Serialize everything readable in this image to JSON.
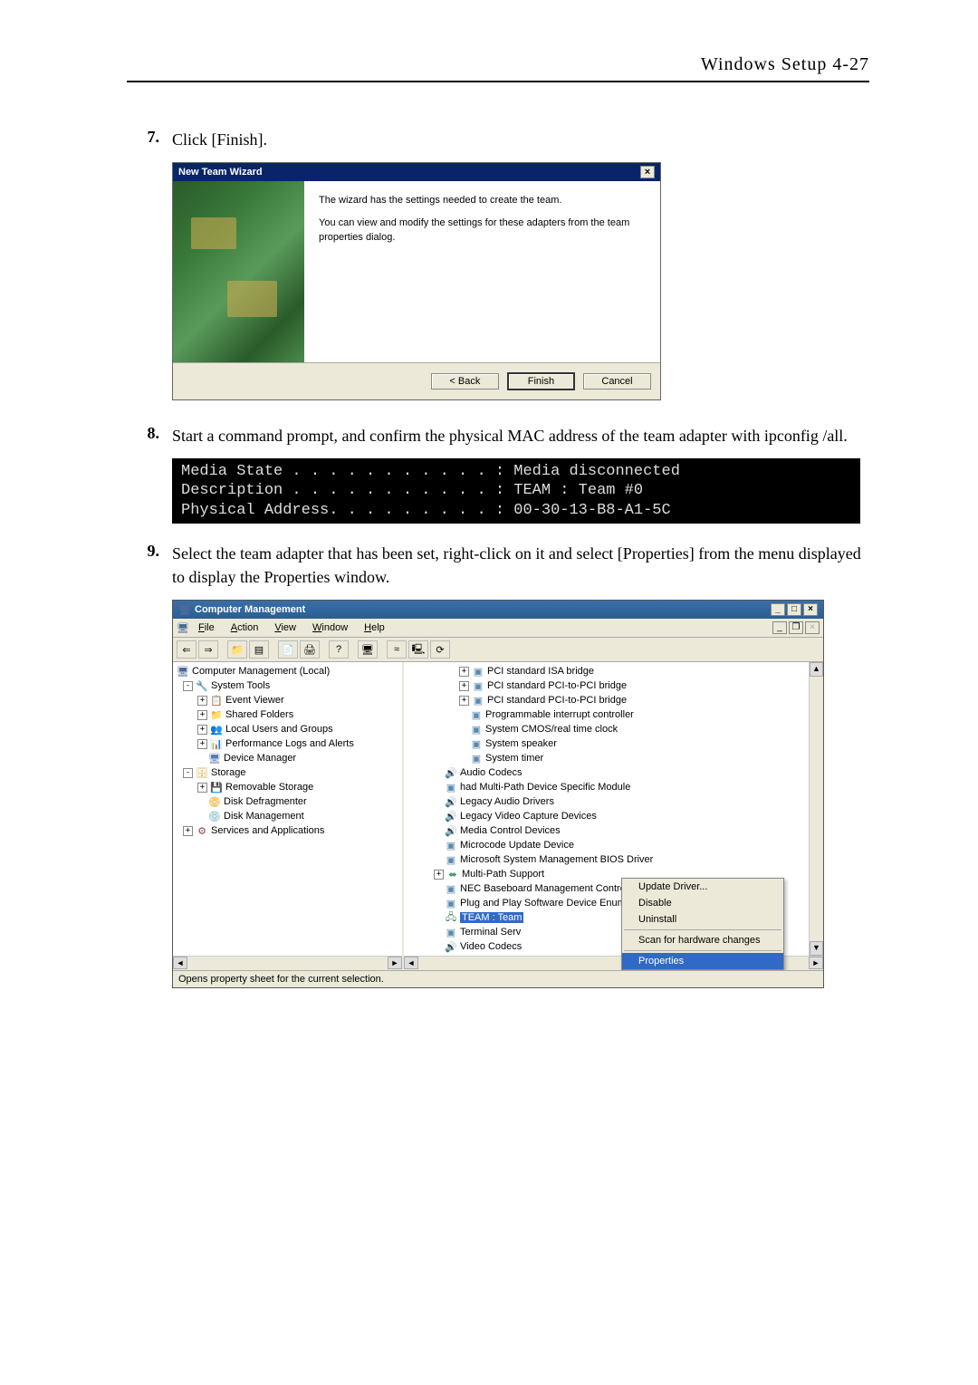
{
  "header": {
    "title": "Windows  Setup   4-27"
  },
  "steps": {
    "s7": {
      "num": "7.",
      "text": "Click [Finish]."
    },
    "s8": {
      "num": "8.",
      "text": "Start a command prompt, and confirm the physical MAC address of the team adapter with ipconfig /all."
    },
    "s9": {
      "num": "9.",
      "text": "Select the team adapter that has been set, right-click on it and select [Properties] from the menu displayed to display the Properties window."
    }
  },
  "wizard": {
    "title": "New Team Wizard",
    "line1": "The wizard has the settings needed to create the team.",
    "line2": "You can view and modify the settings for these adapters from the team properties dialog.",
    "back": "< Back",
    "finish": "Finish",
    "cancel": "Cancel"
  },
  "console": {
    "text": "Media State . . . . . . . . . . . : Media disconnected\nDescription . . . . . . . . . . . : TEAM : Team #0\nPhysical Address. . . . . . . . . : 00-30-13-B8-A1-5C"
  },
  "cm": {
    "title": "Computer Management",
    "menu": {
      "file": "File",
      "action": "Action",
      "view": "View",
      "window": "Window",
      "help": "Help"
    },
    "left": {
      "root": "Computer Management (Local)",
      "systools": "System Tools",
      "ev": "Event Viewer",
      "sf": "Shared Folders",
      "lug": "Local Users and Groups",
      "pla": "Performance Logs and Alerts",
      "dm": "Device Manager",
      "storage": "Storage",
      "rs": "Removable Storage",
      "dd": "Disk Defragmenter",
      "dmg": "Disk Management",
      "sa": "Services and Applications"
    },
    "right": {
      "items": [
        "PCI standard ISA bridge",
        "PCI standard PCI-to-PCI bridge",
        "PCI standard PCI-to-PCI bridge",
        "Programmable interrupt controller",
        "System CMOS/real time clock",
        "System speaker",
        "System timer"
      ],
      "audio": "Audio Codecs",
      "had": "had Multi-Path Device Specific Module",
      "lad": "Legacy Audio Drivers",
      "lvc": "Legacy Video Capture Devices",
      "mcd": "Media Control Devices",
      "mud": "Microcode Update Device",
      "msmb": "Microsoft System Management BIOS Driver",
      "mps": "Multi-Path Support",
      "necb": "NEC Baseboard Management Controller",
      "pnp": "Plug and Play Software Device Enumerator",
      "team": "TEAM : Team",
      "ts": "Terminal Serv",
      "vc": "Video Codecs"
    },
    "ctx": {
      "upd": "Update Driver...",
      "dis": "Disable",
      "uni": "Uninstall",
      "scan": "Scan for hardware changes",
      "prop": "Properties"
    },
    "status": "Opens property sheet for the current selection."
  }
}
